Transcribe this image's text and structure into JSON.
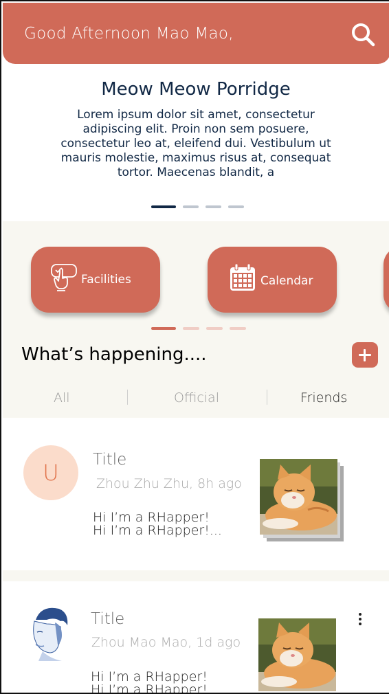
{
  "header": {
    "greeting": "Good Afternoon Mao Mao,",
    "search_icon": "search-icon"
  },
  "feature": {
    "title": "Meow Meow Porridge",
    "body": "Lorem ipsum dolor sit amet, consectetur adipiscing elit. Proin non sem posuere, consectetur leo at, eleifend dui. Vestibulum ut mauris molestie, maximus risus at, consequat tortor. Maecenas blandit, a",
    "carousel_pages": 4,
    "active_page": 1
  },
  "quick_actions": [
    {
      "label": "Facilities",
      "icon": "hand-tap-icon"
    },
    {
      "label": "Calendar",
      "icon": "calendar-icon"
    }
  ],
  "quick_actions_pages": 4,
  "quick_actions_active_page": 1,
  "happening": {
    "heading": "What’s happening....",
    "add_icon": "plus-icon"
  },
  "tabs": [
    {
      "label": "All",
      "active": false
    },
    {
      "label": "Official",
      "active": false
    },
    {
      "label": "Friends",
      "active": true
    }
  ],
  "posts": [
    {
      "avatar_letter": "U",
      "title": "Title",
      "meta": "Zhou Zhu Zhu, 8h ago",
      "text_line1": "Hi I’m a RHapper!",
      "text_line2": "Hi I’m a RHapper!..."
    },
    {
      "title": "Title",
      "meta": "Zhou Mao Mao, 1d ago",
      "text_line1": "Hi I’m a RHapper!",
      "text_line2": "Hi I’m a RHapper!"
    }
  ],
  "colors": {
    "accent": "#d06a58",
    "navy": "#112845",
    "beige": "#f8f7f1"
  }
}
